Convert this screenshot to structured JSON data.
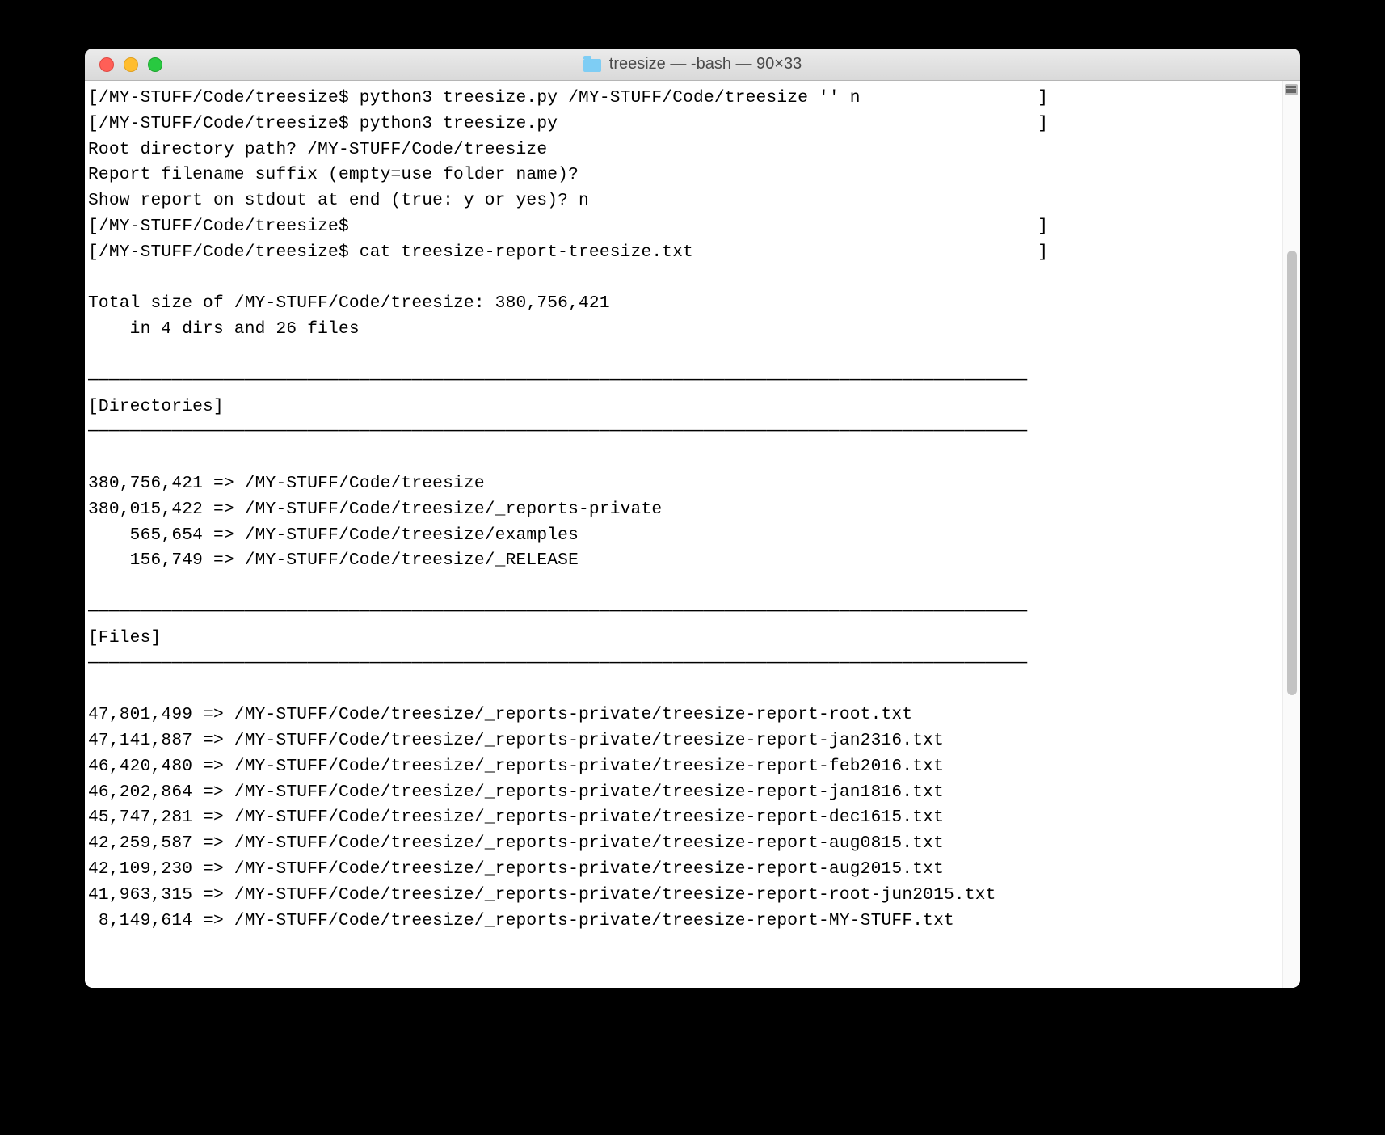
{
  "window": {
    "title": "treesize — -bash — 90×33"
  },
  "terminal": {
    "lines": [
      "[/MY-STUFF/Code/treesize$ python3 treesize.py /MY-STUFF/Code/treesize '' n                 ]",
      "[/MY-STUFF/Code/treesize$ python3 treesize.py                                              ]",
      "Root directory path? /MY-STUFF/Code/treesize",
      "Report filename suffix (empty=use folder name)?",
      "Show report on stdout at end (true: y or yes)? n",
      "[/MY-STUFF/Code/treesize$                                                                  ]",
      "[/MY-STUFF/Code/treesize$ cat treesize-report-treesize.txt                                 ]",
      "",
      "Total size of /MY-STUFF/Code/treesize: 380,756,421",
      "    in 4 dirs and 26 files",
      "",
      "──────────────────────────────────────────────────────────────────────────────────────────",
      "[Directories]",
      "──────────────────────────────────────────────────────────────────────────────────────────",
      "",
      "380,756,421 => /MY-STUFF/Code/treesize",
      "380,015,422 => /MY-STUFF/Code/treesize/_reports-private",
      "    565,654 => /MY-STUFF/Code/treesize/examples",
      "    156,749 => /MY-STUFF/Code/treesize/_RELEASE",
      "",
      "──────────────────────────────────────────────────────────────────────────────────────────",
      "[Files]",
      "──────────────────────────────────────────────────────────────────────────────────────────",
      "",
      "47,801,499 => /MY-STUFF/Code/treesize/_reports-private/treesize-report-root.txt",
      "47,141,887 => /MY-STUFF/Code/treesize/_reports-private/treesize-report-jan2316.txt",
      "46,420,480 => /MY-STUFF/Code/treesize/_reports-private/treesize-report-feb2016.txt",
      "46,202,864 => /MY-STUFF/Code/treesize/_reports-private/treesize-report-jan1816.txt",
      "45,747,281 => /MY-STUFF/Code/treesize/_reports-private/treesize-report-dec1615.txt",
      "42,259,587 => /MY-STUFF/Code/treesize/_reports-private/treesize-report-aug0815.txt",
      "42,109,230 => /MY-STUFF/Code/treesize/_reports-private/treesize-report-aug2015.txt",
      "41,963,315 => /MY-STUFF/Code/treesize/_reports-private/treesize-report-root-jun2015.txt",
      " 8,149,614 => /MY-STUFF/Code/treesize/_reports-private/treesize-report-MY-STUFF.txt"
    ]
  }
}
